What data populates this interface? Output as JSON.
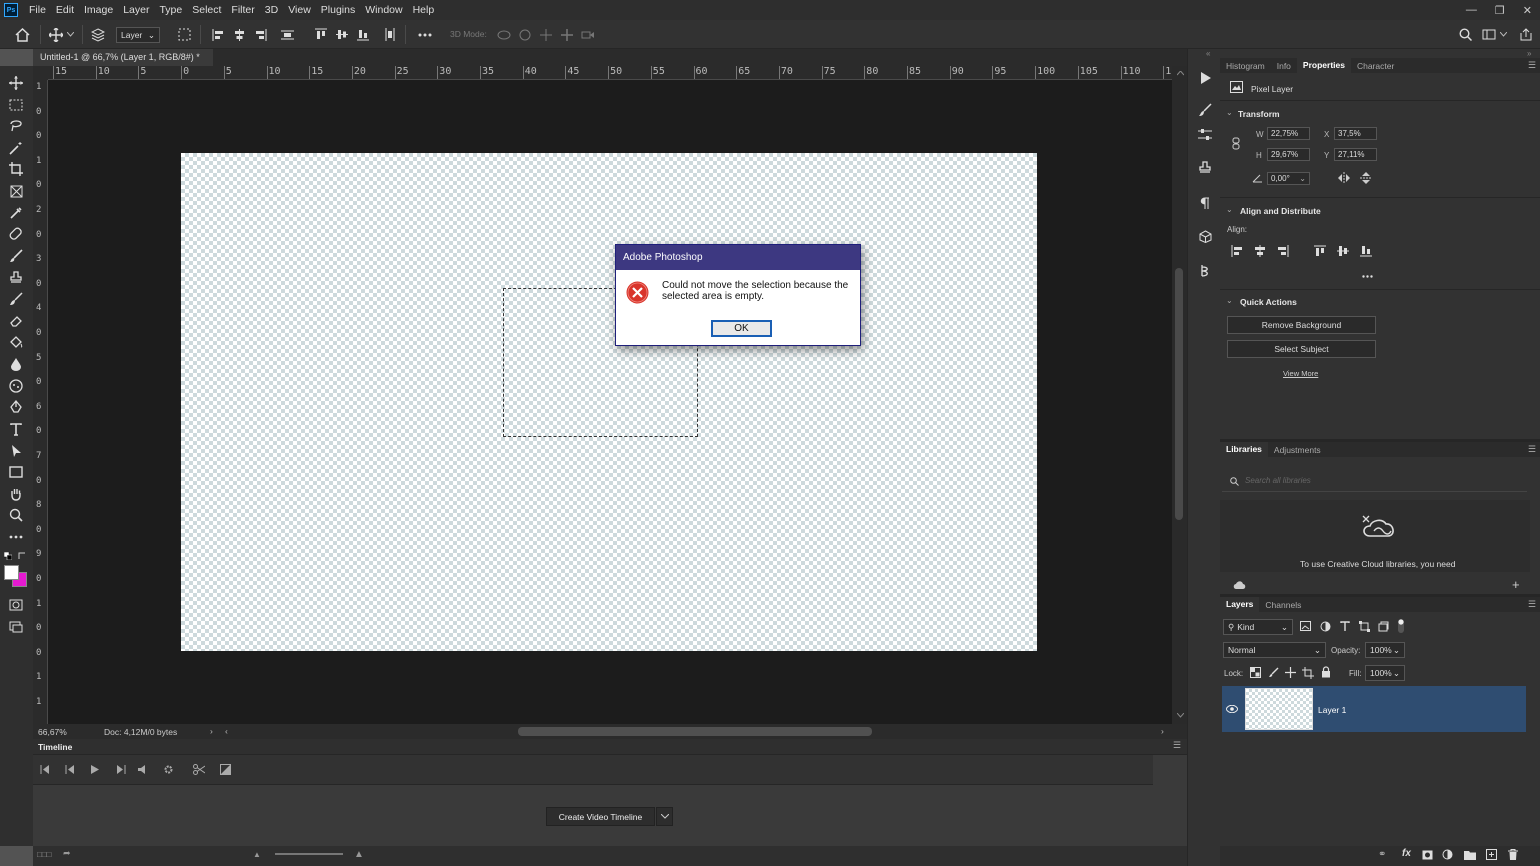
{
  "app": {
    "logo": "Ps",
    "name": "Adobe Photoshop"
  },
  "menubar": {
    "items": [
      "File",
      "Edit",
      "Image",
      "Layer",
      "Type",
      "Select",
      "Filter",
      "3D",
      "View",
      "Plugins",
      "Window",
      "Help"
    ]
  },
  "options": {
    "auto_select_value": "Layer",
    "mode3d_label": "3D Mode:"
  },
  "document": {
    "tab_title": "Untitled-1 @ 66,7% (Layer 1, RGB/8#) *"
  },
  "rulers": {
    "top": [
      "15",
      "10",
      "5",
      "0",
      "5",
      "10",
      "15",
      "20",
      "25",
      "30",
      "35",
      "40",
      "45",
      "50",
      "55",
      "60",
      "65",
      "70",
      "75",
      "80",
      "85",
      "90",
      "95",
      "100",
      "105",
      "110",
      "1"
    ],
    "left": [
      "1",
      "0",
      "0",
      "1",
      "0",
      "2",
      "0",
      "3",
      "0",
      "4",
      "0",
      "5",
      "0",
      "6",
      "0",
      "7",
      "0",
      "8",
      "0",
      "9",
      "0",
      "1",
      "0",
      "0",
      "1",
      "1"
    ]
  },
  "status": {
    "zoom": "66,67%",
    "doc": "Doc: 4,12M/0 bytes"
  },
  "timeline": {
    "title": "Timeline",
    "create_button": "Create Video Timeline"
  },
  "properties": {
    "tabs": [
      "Histogram",
      "Info",
      "Properties",
      "Character"
    ],
    "active_tab": "Properties",
    "kind": "Pixel Layer",
    "transform": {
      "title": "Transform",
      "w_label": "W",
      "w": "22,75%",
      "h_label": "H",
      "h": "29,67%",
      "x_label": "X",
      "x": "37,5%",
      "y_label": "Y",
      "y": "27,11%",
      "angle": "0,00°"
    },
    "align": {
      "title": "Align and Distribute",
      "label": "Align:"
    },
    "quick_actions": {
      "title": "Quick Actions",
      "remove_bg": "Remove Background",
      "select_subject": "Select Subject",
      "view_more": "View More"
    }
  },
  "libraries": {
    "tabs": [
      "Libraries",
      "Adjustments"
    ],
    "search_placeholder": "Search all libraries",
    "message": "To use Creative Cloud libraries, you need"
  },
  "layers": {
    "tabs": [
      "Layers",
      "Channels"
    ],
    "filter_kind": "Kind",
    "blend_mode": "Normal",
    "opacity_label": "Opacity:",
    "opacity": "100%",
    "lock_label": "Lock:",
    "fill_label": "Fill:",
    "fill": "100%",
    "items": [
      {
        "name": "Layer 1",
        "visible": true,
        "selected": true
      }
    ]
  },
  "dialog": {
    "title": "Adobe Photoshop",
    "message": "Could not move the selection because the selected area is empty.",
    "ok": "OK"
  },
  "colors": {
    "accent": "#31a8ff",
    "dialog_title": "#3d3881",
    "layer_selected": "#2f4d71",
    "error": "#d9342b"
  }
}
